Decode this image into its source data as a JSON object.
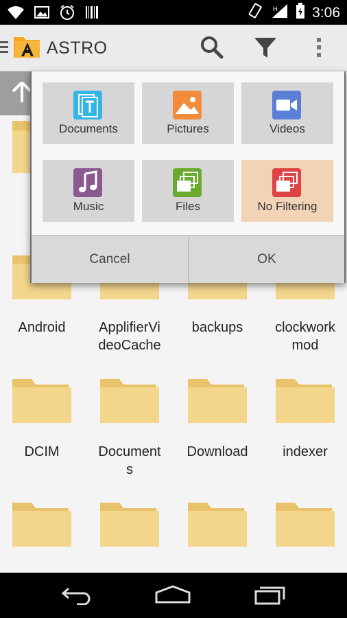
{
  "status_bar": {
    "time": "3:06"
  },
  "app": {
    "title": "ASTRO"
  },
  "folders": [
    {
      "label": "Android"
    },
    {
      "label": "ApplifierVi\ndeoCache"
    },
    {
      "label": "backups"
    },
    {
      "label": "clockwork\nmod"
    },
    {
      "label": "DCIM"
    },
    {
      "label": "Document\ns"
    },
    {
      "label": "Download"
    },
    {
      "label": "indexer"
    }
  ],
  "filter_dialog": {
    "options": [
      {
        "label": "Documents",
        "icon": "documents-icon",
        "color": "#33b5e5"
      },
      {
        "label": "Pictures",
        "icon": "pictures-icon",
        "color": "#f28c3c"
      },
      {
        "label": "Videos",
        "icon": "videos-icon",
        "color": "#5b7fd6"
      },
      {
        "label": "Music",
        "icon": "music-icon",
        "color": "#8a5a8f"
      },
      {
        "label": "Files",
        "icon": "files-icon",
        "color": "#6aaa2e"
      },
      {
        "label": "No Filtering",
        "icon": "no-filtering-icon",
        "color": "#e04343",
        "selected": true
      }
    ],
    "cancel_label": "Cancel",
    "ok_label": "OK"
  }
}
